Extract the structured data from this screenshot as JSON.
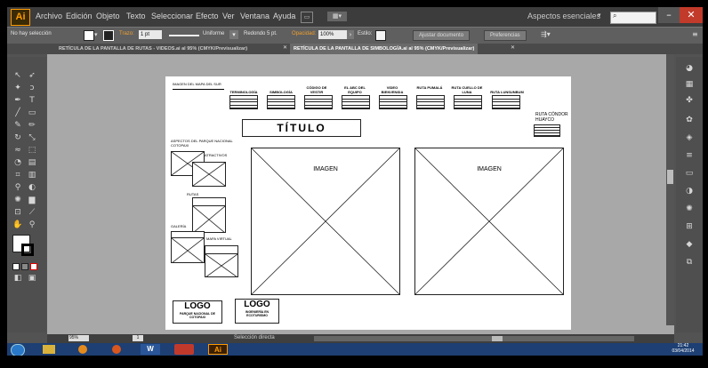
{
  "app": {
    "logo": "Ai"
  },
  "menubar": {
    "items": [
      "Archivo",
      "Edición",
      "Objeto",
      "Texto",
      "Seleccionar",
      "Efecto",
      "Ver",
      "Ventana",
      "Ayuda"
    ],
    "workspace": "Aspectos esenciales"
  },
  "control_bar": {
    "selection": "No hay selección",
    "stroke_label": "Trazo:",
    "stroke_value": "1 pt",
    "profile": "Uniforme",
    "brush": "Redondo 5 pt.",
    "opacity_label": "Opacidad:",
    "opacity_value": "100%",
    "style_label": "Estilo:",
    "doc_setup": "Ajustar documento",
    "prefs": "Preferencias"
  },
  "tabs": [
    "RETÍCULA DE LA PANTALLA DE RUTAS - VIDEOS.ai al 95% (CMYK/Previsualizar)",
    "RETÍCULA DE LA PANTALLA DE SIMBOLOGÍA.ai al 95% (CMYK/Previsualizar)"
  ],
  "artboard": {
    "map_label": "IMAGEN DEL MAPA DEL SUR",
    "nav": [
      "TERMINOLOGÍA",
      "SIMBOLOGÍA",
      "CÓDIGO DE VESTIR",
      "EL ABC DEL EQUIPO",
      "VIDEO BIENVENIDA",
      "RUTA PUMALÁ",
      "RUTA CUELLO DE LUNA",
      "RUTA LUNSUNBUM"
    ],
    "title": "TÍTULO",
    "route_condor": "RUTA CÓNDOR HUAYCO",
    "aspects": "ASPECTOS DEL PARQUE NACIONAL COTOPAXI",
    "attractions": "ATRACTIVOS",
    "routes": "RUTAS",
    "gallery": "GALERÍA",
    "virtual_map": "MAPA VIRTUAL",
    "image1": "IMAGEN",
    "image2": "IMAGEN",
    "logo1": "LOGO",
    "logo1_caption": "PARQUE NACIONAL DE COTOPAXI",
    "logo2": "LOGO",
    "logo2_caption": "INGENIERÍA EN ECOTURISMO"
  },
  "status": {
    "zoom": "95%",
    "page": "1",
    "tool": "Selección directa"
  },
  "taskbar": {
    "time": "21:42",
    "date": "03/04/2014"
  },
  "colors": {
    "ai_orange": "#ff9a00",
    "taskbar": "#1d3f73"
  }
}
